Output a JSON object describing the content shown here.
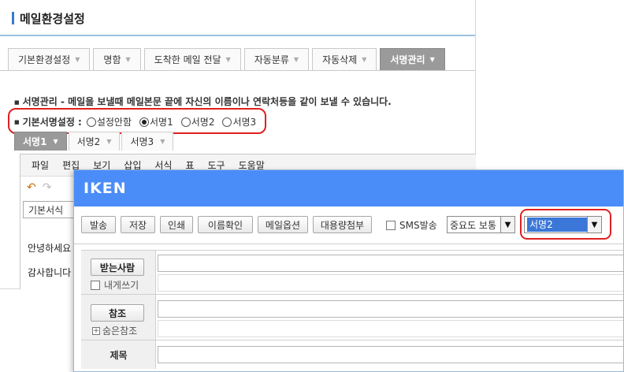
{
  "settings": {
    "title": "메일환경설정",
    "tabs": [
      {
        "label": "기본환경설정"
      },
      {
        "label": "명함"
      },
      {
        "label": "도착한 메일 전달"
      },
      {
        "label": "자동분류"
      },
      {
        "label": "자동삭제"
      },
      {
        "label": "서명관리",
        "active": true
      }
    ],
    "description": "서명관리 - 메일을 보낼때 메일본문 끝에 자신의 이름이나 연락처등을 같이 보낼 수 있습니다.",
    "default_signature": {
      "label": "기본서명설정 :",
      "options": [
        "설정안함",
        "서명1",
        "서명2",
        "서명3"
      ],
      "selected": "서명1"
    },
    "signature_tabs": [
      "서명1",
      "서명2",
      "서명3"
    ],
    "editor": {
      "menu": [
        "파일",
        "편집",
        "보기",
        "삽입",
        "서식",
        "표",
        "도구",
        "도움말"
      ],
      "style_select": "기본서식",
      "body_lines": [
        "안녕하세요",
        "감사합니다"
      ]
    }
  },
  "compose": {
    "logo": "IKEN",
    "toolbar": {
      "send": "발송",
      "save": "저장",
      "print": "인쇄",
      "name_check": "이름확인",
      "mail_options": "메일옵션",
      "large_attach": "대용량첨부",
      "sms_label": "SMS발송",
      "sms_checked": false,
      "priority": "중요도 보통",
      "signature_select": "서명2"
    },
    "form": {
      "to_button": "받는사람",
      "self_label": "내게쓰기",
      "cc_button": "참조",
      "bcc_label": "숨은참조",
      "subject_label": "제목"
    }
  },
  "colors": {
    "header_blue": "#4b8df8",
    "highlight_red": "#e02020",
    "selection_blue": "#3a77d8",
    "active_tab_gray": "#9a9a9a"
  }
}
